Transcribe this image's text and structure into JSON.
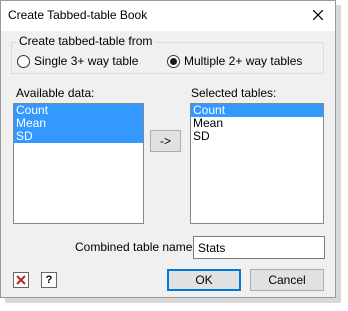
{
  "window": {
    "title": "Create Tabbed-table Book"
  },
  "group": {
    "legend": "Create tabbed-table from",
    "options": [
      {
        "label": "Single 3+ way table",
        "checked": false
      },
      {
        "label": "Multiple 2+ way tables",
        "checked": true
      }
    ]
  },
  "available": {
    "label": "Available data:",
    "items": [
      "Count",
      "Mean",
      "SD"
    ]
  },
  "move_button": {
    "label": "->"
  },
  "selected": {
    "label": "Selected tables:",
    "items": [
      "Count",
      "Mean",
      "SD"
    ]
  },
  "combined": {
    "label": "Combined table name:",
    "value": "Stats"
  },
  "footer": {
    "ok_label": "OK",
    "cancel_label": "Cancel"
  },
  "icons": {
    "clear": "clear-x-icon",
    "help": "help-icon"
  }
}
